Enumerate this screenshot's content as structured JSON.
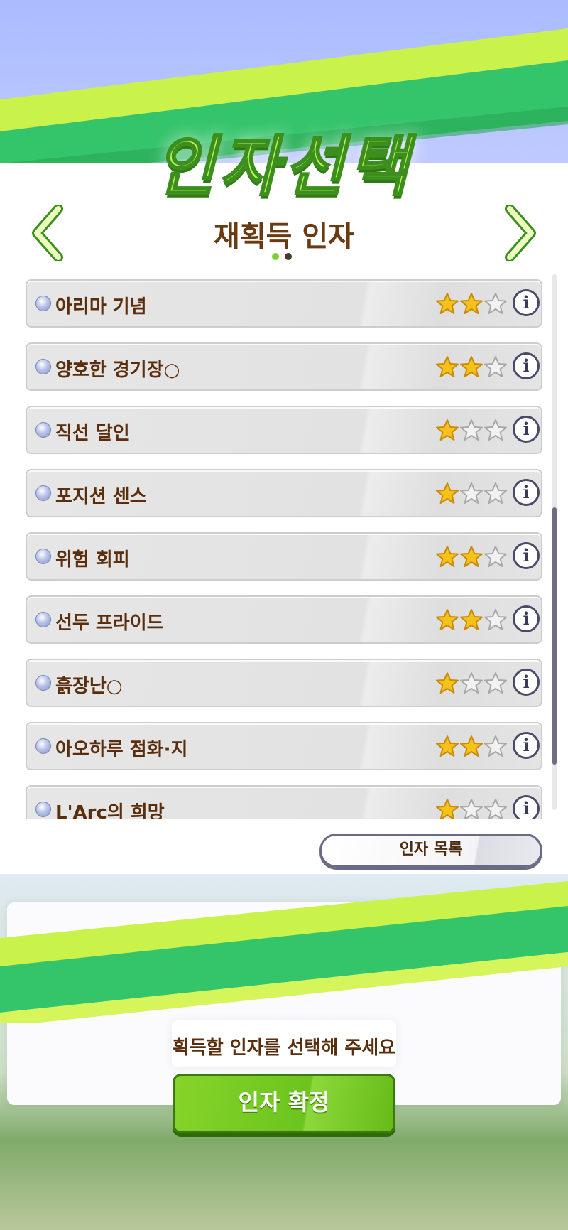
{
  "header": {
    "title": "인자선택",
    "subtitle": "재획득 인자"
  },
  "pagination": {
    "current": 1,
    "total": 2
  },
  "factors": [
    {
      "label": "아리마 기념",
      "stars": 2
    },
    {
      "label": "양호한 경기장○",
      "stars": 2
    },
    {
      "label": "직선 달인",
      "stars": 1
    },
    {
      "label": "포지션 센스",
      "stars": 1
    },
    {
      "label": "위험 회피",
      "stars": 2
    },
    {
      "label": "선두 프라이드",
      "stars": 2
    },
    {
      "label": "흙장난○",
      "stars": 1
    },
    {
      "label": "아오하루 점화·지",
      "stars": 2
    },
    {
      "label": "L'Arc의 희망",
      "stars": 1
    }
  ],
  "max_stars": 3,
  "info_glyph": "i",
  "buttons": {
    "factor_list": "인자 목록",
    "confirm": "인자 확정"
  },
  "prompt": "획득할 인자를 선택해 주세요",
  "colors": {
    "title_green": "#b9f25a",
    "text_brown": "#5a2e0c",
    "star_gold": "#f5c21a",
    "confirm_green": "#6cc41e",
    "sky_blue": "#a9bcff"
  }
}
